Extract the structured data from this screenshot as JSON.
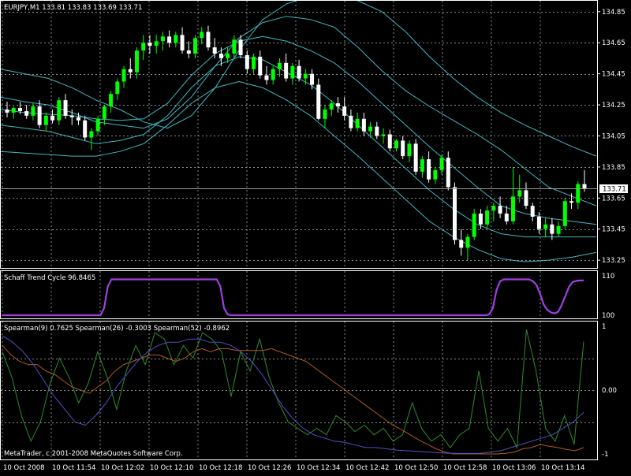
{
  "window": {
    "symbol_header": "EURJPY,M1  133.81 133.83 133.69 133.71",
    "copyright": "MetaTrader, c 2001-2008 MetaQuotes Software Corp."
  },
  "colors": {
    "background": "#000000",
    "bull_candle": "#00ff00",
    "bear_candle": "#ffffff",
    "envelope": "#40b8c0",
    "stc": "#a040e0",
    "spearman9": "#2e8b2e",
    "spearman26": "#b4581c",
    "spearman52": "#5050c8",
    "grid": "#8a8a8a",
    "text": "#ffffff",
    "price_box_bg": "#ffffff",
    "price_box_text": "#000000"
  },
  "chart_data": [
    {
      "type": "candlestick",
      "title": "EURJPY,M1",
      "header_values": {
        "open": 133.81,
        "high": 133.83,
        "low": 133.69,
        "close": 133.71
      },
      "current_price": "133.71",
      "ylim": [
        133.2,
        134.92
      ],
      "y_ticks": [
        "134.85",
        "134.65",
        "134.45",
        "134.25",
        "134.05",
        "133.85",
        "133.65",
        "133.45",
        "133.25"
      ],
      "x_tick_labels": [
        "10 Oct 2008",
        "10 Oct 11:54",
        "10 Oct 12:02",
        "10 Oct 12:10",
        "10 Oct 12:18",
        "10 Oct 12:26",
        "10 Oct 12:34",
        "10 Oct 12:42",
        "10 Oct 12:50",
        "10 Oct 12:58",
        "10 Oct 13:06",
        "10 Oct 13:14"
      ],
      "grid": true,
      "candles": [
        [
          134.22,
          134.27,
          134.17,
          134.2
        ],
        [
          134.2,
          134.24,
          134.16,
          134.23
        ],
        [
          134.23,
          134.27,
          134.19,
          134.21
        ],
        [
          134.21,
          134.25,
          134.16,
          134.18
        ],
        [
          134.18,
          134.26,
          134.15,
          134.24
        ],
        [
          134.24,
          134.28,
          134.1,
          134.12
        ],
        [
          134.12,
          134.2,
          134.08,
          134.18
        ],
        [
          134.18,
          134.22,
          134.13,
          134.15
        ],
        [
          134.15,
          134.3,
          134.12,
          134.28
        ],
        [
          134.28,
          134.32,
          134.16,
          134.18
        ],
        [
          134.18,
          134.22,
          134.12,
          134.17
        ],
        [
          134.17,
          134.2,
          134.12,
          134.15
        ],
        [
          134.15,
          134.18,
          134.02,
          134.04
        ],
        [
          134.04,
          134.1,
          133.96,
          134.08
        ],
        [
          134.08,
          134.18,
          134.05,
          134.16
        ],
        [
          134.16,
          134.25,
          134.12,
          134.24
        ],
        [
          134.24,
          134.34,
          134.2,
          134.32
        ],
        [
          134.32,
          134.42,
          134.28,
          134.4
        ],
        [
          134.4,
          134.5,
          134.36,
          134.48
        ],
        [
          134.48,
          134.55,
          134.42,
          134.46
        ],
        [
          134.46,
          134.62,
          134.42,
          134.6
        ],
        [
          134.6,
          134.7,
          134.54,
          134.65
        ],
        [
          134.65,
          134.7,
          134.58,
          134.63
        ],
        [
          134.63,
          134.7,
          134.58,
          134.66
        ],
        [
          134.66,
          134.72,
          134.6,
          134.69
        ],
        [
          134.69,
          134.73,
          134.62,
          134.65
        ],
        [
          134.65,
          134.72,
          134.62,
          134.7
        ],
        [
          134.7,
          134.75,
          134.58,
          134.6
        ],
        [
          134.6,
          134.66,
          134.55,
          134.58
        ],
        [
          134.58,
          134.7,
          134.55,
          134.68
        ],
        [
          134.68,
          134.75,
          134.64,
          134.72
        ],
        [
          134.72,
          134.76,
          134.6,
          134.62
        ],
        [
          134.62,
          134.68,
          134.55,
          134.58
        ],
        [
          134.58,
          134.62,
          134.5,
          134.55
        ],
        [
          134.55,
          134.62,
          134.52,
          134.58
        ],
        [
          134.58,
          134.7,
          134.55,
          134.67
        ],
        [
          134.67,
          134.7,
          134.55,
          134.57
        ],
        [
          134.57,
          134.6,
          134.45,
          134.48
        ],
        [
          134.48,
          134.58,
          134.45,
          134.56
        ],
        [
          134.56,
          134.6,
          134.42,
          134.44
        ],
        [
          134.44,
          134.5,
          134.38,
          134.41
        ],
        [
          134.41,
          134.5,
          134.38,
          134.48
        ],
        [
          134.48,
          134.55,
          134.43,
          134.52
        ],
        [
          134.52,
          134.58,
          134.4,
          134.42
        ],
        [
          134.42,
          134.52,
          134.38,
          134.5
        ],
        [
          134.5,
          134.54,
          134.4,
          134.42
        ],
        [
          134.42,
          134.48,
          134.38,
          134.45
        ],
        [
          134.45,
          134.48,
          134.35,
          134.38
        ],
        [
          134.38,
          134.42,
          134.15,
          134.16
        ],
        [
          134.16,
          134.25,
          134.1,
          134.22
        ],
        [
          134.22,
          134.28,
          134.18,
          134.26
        ],
        [
          134.26,
          134.3,
          134.2,
          134.24
        ],
        [
          134.24,
          134.3,
          134.15,
          134.18
        ],
        [
          134.18,
          134.22,
          134.08,
          134.1
        ],
        [
          134.1,
          134.2,
          134.08,
          134.16
        ],
        [
          134.16,
          134.2,
          134.05,
          134.08
        ],
        [
          134.08,
          134.14,
          134.04,
          134.11
        ],
        [
          134.11,
          134.14,
          134.03,
          134.05
        ],
        [
          134.05,
          134.1,
          134.0,
          134.06
        ],
        [
          134.06,
          134.09,
          133.95,
          133.97
        ],
        [
          133.97,
          134.03,
          133.95,
          134.02
        ],
        [
          134.02,
          134.05,
          133.9,
          133.92
        ],
        [
          133.92,
          134.02,
          133.88,
          134.0
        ],
        [
          134.0,
          134.03,
          133.8,
          133.82
        ],
        [
          133.82,
          133.92,
          133.78,
          133.9
        ],
        [
          133.9,
          133.95,
          133.75,
          133.77
        ],
        [
          133.77,
          133.85,
          133.74,
          133.83
        ],
        [
          133.83,
          133.93,
          133.8,
          133.91
        ],
        [
          133.91,
          133.95,
          133.7,
          133.72
        ],
        [
          133.72,
          133.75,
          133.35,
          133.38
        ],
        [
          133.38,
          133.45,
          133.28,
          133.33
        ],
        [
          133.33,
          133.42,
          133.25,
          133.4
        ],
        [
          133.4,
          133.58,
          133.38,
          133.55
        ],
        [
          133.55,
          133.58,
          133.45,
          133.48
        ],
        [
          133.48,
          133.6,
          133.45,
          133.57
        ],
        [
          133.57,
          133.62,
          133.5,
          133.6
        ],
        [
          133.6,
          133.66,
          133.52,
          133.55
        ],
        [
          133.55,
          133.6,
          133.48,
          133.5
        ],
        [
          133.5,
          133.85,
          133.48,
          133.66
        ],
        [
          133.66,
          133.8,
          133.62,
          133.7
        ],
        [
          133.7,
          133.75,
          133.58,
          133.6
        ],
        [
          133.6,
          133.62,
          133.5,
          133.53
        ],
        [
          133.53,
          133.56,
          133.42,
          133.45
        ],
        [
          133.45,
          133.52,
          133.4,
          133.48
        ],
        [
          133.48,
          133.52,
          133.38,
          133.42
        ],
        [
          133.42,
          133.5,
          133.4,
          133.47
        ],
        [
          133.47,
          133.65,
          133.45,
          133.63
        ],
        [
          133.63,
          133.68,
          133.58,
          133.62
        ],
        [
          133.62,
          133.76,
          133.58,
          133.74
        ],
        [
          133.74,
          133.83,
          133.69,
          133.71
        ]
      ],
      "envelope_bands": [
        {
          "name": "outer-upper",
          "values": [
            134.48,
            134.45,
            134.42,
            134.36,
            134.28,
            134.22,
            134.14,
            134.1,
            134.18,
            134.36,
            134.6,
            134.8,
            134.9,
            134.95,
            134.96,
            134.92,
            134.85,
            134.72,
            134.56,
            134.42,
            134.3,
            134.2,
            134.12,
            134.05,
            133.98,
            133.92
          ]
        },
        {
          "name": "upper",
          "values": [
            134.3,
            134.27,
            134.25,
            134.2,
            134.14,
            134.12,
            134.1,
            134.16,
            134.3,
            134.5,
            134.68,
            134.78,
            134.82,
            134.8,
            134.75,
            134.62,
            134.47,
            134.34,
            134.24,
            134.15,
            134.06,
            133.96,
            133.84,
            133.72,
            133.66,
            133.6
          ]
        },
        {
          "name": "middle",
          "values": [
            134.22,
            134.2,
            134.19,
            134.18,
            134.16,
            134.15,
            134.16,
            134.26,
            134.44,
            134.58,
            134.66,
            134.69,
            134.66,
            134.6,
            134.52,
            134.4,
            134.26,
            134.12,
            133.98,
            133.85,
            133.72,
            133.6,
            133.55,
            133.52,
            133.5,
            133.48
          ]
        },
        {
          "name": "lower",
          "values": [
            134.12,
            134.1,
            134.08,
            134.04,
            134.0,
            134.02,
            134.06,
            134.18,
            134.36,
            134.5,
            134.56,
            134.54,
            134.46,
            134.38,
            134.26,
            134.12,
            133.98,
            133.84,
            133.7,
            133.58,
            133.48,
            133.42,
            133.4,
            133.4,
            133.4,
            133.4
          ]
        },
        {
          "name": "outer-lower",
          "values": [
            133.95,
            133.94,
            133.93,
            133.92,
            133.92,
            133.95,
            134.0,
            134.12,
            134.26,
            134.36,
            134.4,
            134.36,
            134.28,
            134.18,
            134.05,
            133.92,
            133.78,
            133.64,
            133.5,
            133.4,
            133.32,
            133.26,
            133.24,
            133.25,
            133.27,
            133.3
          ]
        }
      ]
    },
    {
      "type": "line",
      "title": "Schaff Trend Cycle 96.8465",
      "ylim": [
        0,
        110
      ],
      "y_ticks": [
        "110",
        "100"
      ],
      "series": [
        {
          "name": "Schaff Trend Cycle",
          "values": [
            0,
            0,
            0,
            0,
            0,
            0,
            0,
            0,
            0,
            0,
            0,
            0,
            0,
            0,
            0,
            0,
            0,
            0,
            0,
            0,
            0,
            0,
            0,
            0,
            0,
            0,
            0,
            0,
            20,
            80,
            100,
            100,
            100,
            100,
            100,
            100,
            100,
            100,
            100,
            100,
            100,
            100,
            100,
            100,
            100,
            100,
            100,
            100,
            100,
            100,
            100,
            100,
            100,
            100,
            100,
            100,
            100,
            100,
            100,
            100,
            80,
            20,
            2,
            0,
            0,
            0,
            0,
            0,
            0,
            0,
            0,
            0,
            0,
            0,
            0,
            0,
            0,
            0,
            0,
            0,
            0,
            0,
            0,
            0,
            0,
            0,
            0,
            0,
            0,
            0,
            0,
            0,
            0,
            0,
            0,
            0,
            0,
            0,
            0,
            0,
            0,
            0,
            0,
            0,
            0,
            0,
            0,
            0,
            0,
            0,
            0,
            0,
            0,
            0,
            0,
            0,
            0,
            0,
            0,
            0,
            0,
            0,
            0,
            0,
            0,
            0,
            0,
            0,
            0,
            0,
            0,
            0,
            0,
            0,
            2,
            20,
            70,
            95,
            100,
            100,
            100,
            100,
            100,
            100,
            100,
            100,
            95,
            85,
            60,
            30,
            15,
            8,
            5,
            10,
            30,
            55,
            80,
            93,
            96,
            97,
            97
          ]
        }
      ]
    },
    {
      "type": "line",
      "title": "Spearman(9) 0.7625  Spearman(26) -0.3003  Spearman(52) -0.8962",
      "ylim": [
        -1,
        1
      ],
      "y_ticks": [
        "1",
        "0.00",
        "-1"
      ],
      "series": [
        {
          "name": "Spearman(9)",
          "values": [
            0.6,
            0.2,
            -0.4,
            -0.8,
            -0.5,
            0.1,
            0.5,
            0.2,
            -0.2,
            0.1,
            0.6,
            0.2,
            -0.3,
            0.3,
            0.7,
            0.4,
            0.9,
            0.8,
            0.4,
            0.7,
            0.5,
            0.9,
            0.8,
            0.6,
            -0.1,
            0.6,
            0.3,
            0.8,
            0.2,
            -0.2,
            -0.5,
            -0.6,
            -0.7,
            -0.6,
            -0.7,
            -0.4,
            -0.5,
            -0.65,
            -0.55,
            -0.7,
            -0.6,
            -0.8,
            -0.7,
            -0.2,
            -0.6,
            -0.8,
            -0.7,
            -0.9,
            -0.7,
            -0.6,
            0.3,
            -0.6,
            -0.8,
            -0.6,
            -0.9,
            0.95,
            0.3,
            -0.6,
            -0.8,
            -0.4,
            -0.85,
            0.76
          ]
        },
        {
          "name": "Spearman(26)",
          "values": [
            0.7,
            0.55,
            0.45,
            0.4,
            0.4,
            0.3,
            0.25,
            0.15,
            0.05,
            0.0,
            -0.05,
            0.05,
            0.15,
            0.3,
            0.4,
            0.45,
            0.5,
            0.55,
            0.55,
            0.5,
            0.45,
            0.5,
            0.6,
            0.65,
            0.6,
            0.65,
            0.65,
            0.62,
            0.62,
            0.62,
            0.62,
            0.65,
            0.6,
            0.55,
            0.5,
            0.45,
            0.35,
            0.25,
            0.15,
            0.05,
            -0.05,
            -0.15,
            -0.25,
            -0.35,
            -0.45,
            -0.55,
            -0.62,
            -0.7,
            -0.78,
            -0.85,
            -0.92,
            -0.97,
            -1.0,
            -1.0,
            -1.0,
            -1.0,
            -1.0,
            -1.0,
            -0.99,
            -0.97,
            -0.92,
            -0.9,
            -0.85,
            -0.88,
            -0.9,
            -0.93,
            -0.95,
            -0.9
          ]
        },
        {
          "name": "Spearman(52)",
          "values": [
            0.85,
            0.75,
            0.6,
            0.4,
            0.15,
            -0.1,
            -0.3,
            -0.5,
            -0.55,
            -0.4,
            -0.2,
            0.05,
            0.25,
            0.45,
            0.6,
            0.7,
            0.75,
            0.75,
            0.8,
            0.8,
            0.75,
            0.75,
            0.7,
            0.6,
            0.45,
            0.25,
            0.0,
            -0.25,
            -0.45,
            -0.6,
            -0.7,
            -0.75,
            -0.8,
            -0.82,
            -0.86,
            -0.9,
            -0.9,
            -0.92,
            -0.94,
            -0.95,
            -0.96,
            -0.97,
            -0.98,
            -0.99,
            -0.99,
            -0.99,
            -0.99,
            -0.97,
            -0.95,
            -0.9,
            -0.85,
            -0.8,
            -0.75,
            -0.7,
            -0.6,
            -0.5,
            -0.35
          ]
        }
      ]
    }
  ]
}
